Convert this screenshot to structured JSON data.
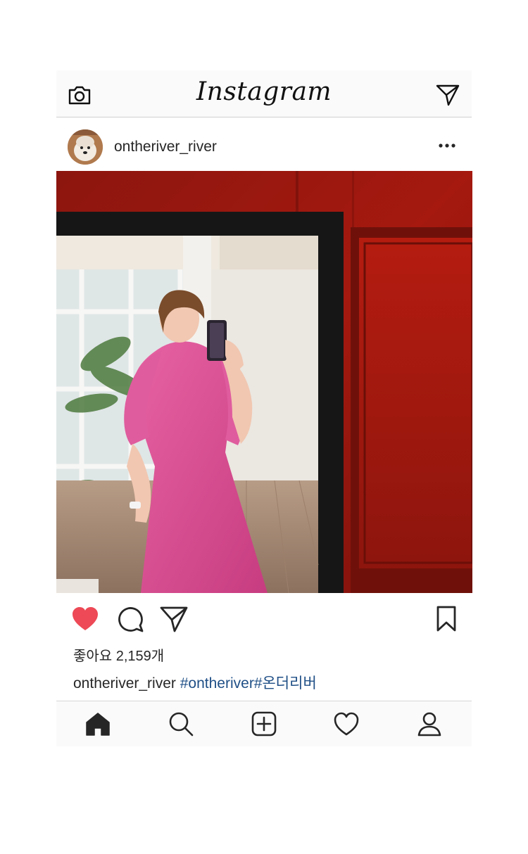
{
  "app": {
    "brand": "Instagram"
  },
  "topbar": {
    "camera_icon": "camera-icon",
    "direct_icon": "paper-plane-icon"
  },
  "post": {
    "username": "ontheriver_river",
    "more_icon": "more-dots-icon",
    "likes_text": "좋아요 2,159개",
    "caption_user": "ontheriver_river",
    "caption_tags": "#ontheriver#온더리버",
    "liked": true,
    "like_color": "#ed4956"
  },
  "actions": [
    "heart-icon",
    "comment-icon",
    "share-icon",
    "bookmark-icon"
  ],
  "bottom_nav": [
    "home-icon",
    "search-icon",
    "add-post-icon",
    "activity-heart-icon",
    "profile-icon"
  ]
}
